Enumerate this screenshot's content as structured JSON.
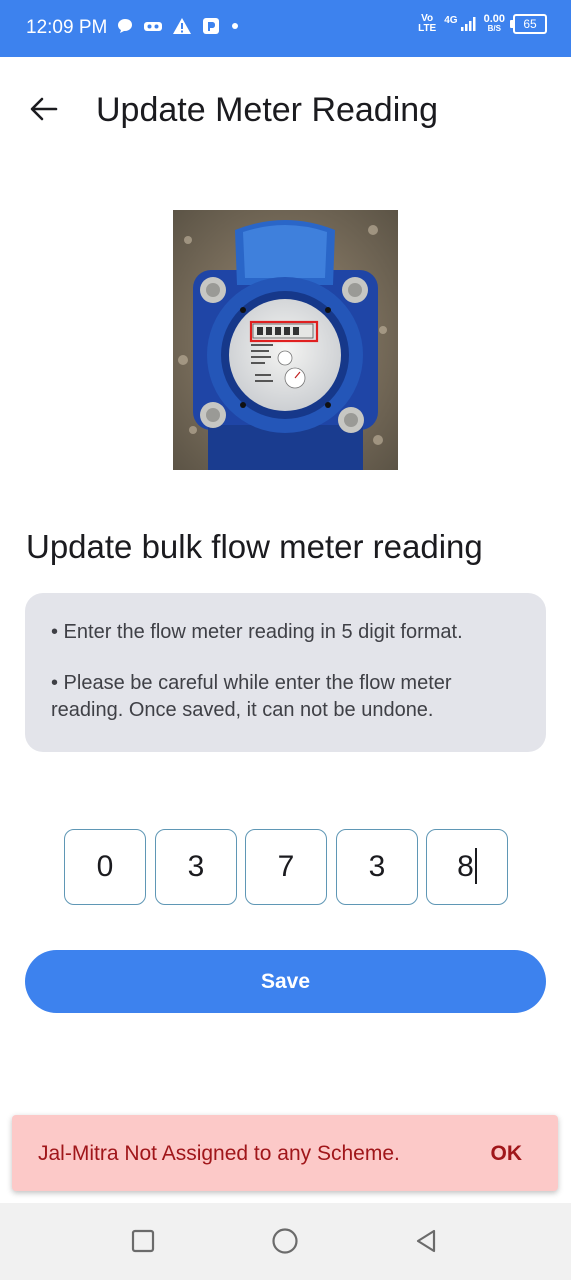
{
  "status_bar": {
    "time": "12:09 PM",
    "network_top": "Vo",
    "network_bottom": "LTE",
    "signal_label": "4G",
    "data_speed_top": "0.00",
    "data_speed_bottom": "B/S",
    "battery": "65",
    "icons": [
      "chat-bubble-icon",
      "infinity-icon",
      "warning-icon",
      "app-badge-icon",
      "dot-icon"
    ]
  },
  "header": {
    "title": "Update Meter Reading",
    "back_icon": "arrow-left-icon"
  },
  "meter_image": {
    "description_icon": "water-meter-photo"
  },
  "section": {
    "heading": "Update bulk flow meter reading"
  },
  "instructions": {
    "line1": "• Enter the flow meter reading in 5 digit format.",
    "line2": "• Please be careful while enter the flow meter reading. Once saved, it can not be undone."
  },
  "reading": {
    "digits": [
      "0",
      "3",
      "7",
      "3",
      "8"
    ]
  },
  "actions": {
    "save_label": "Save"
  },
  "snackbar": {
    "message": "Jal-Mitra Not Assigned to any Scheme.",
    "action": "OK"
  },
  "colors": {
    "primary": "#3d82ee",
    "snackbar_bg": "#fcc9c8",
    "snackbar_text": "#a0161a",
    "card_bg": "#e3e4ea",
    "input_border": "#5f97b5"
  }
}
